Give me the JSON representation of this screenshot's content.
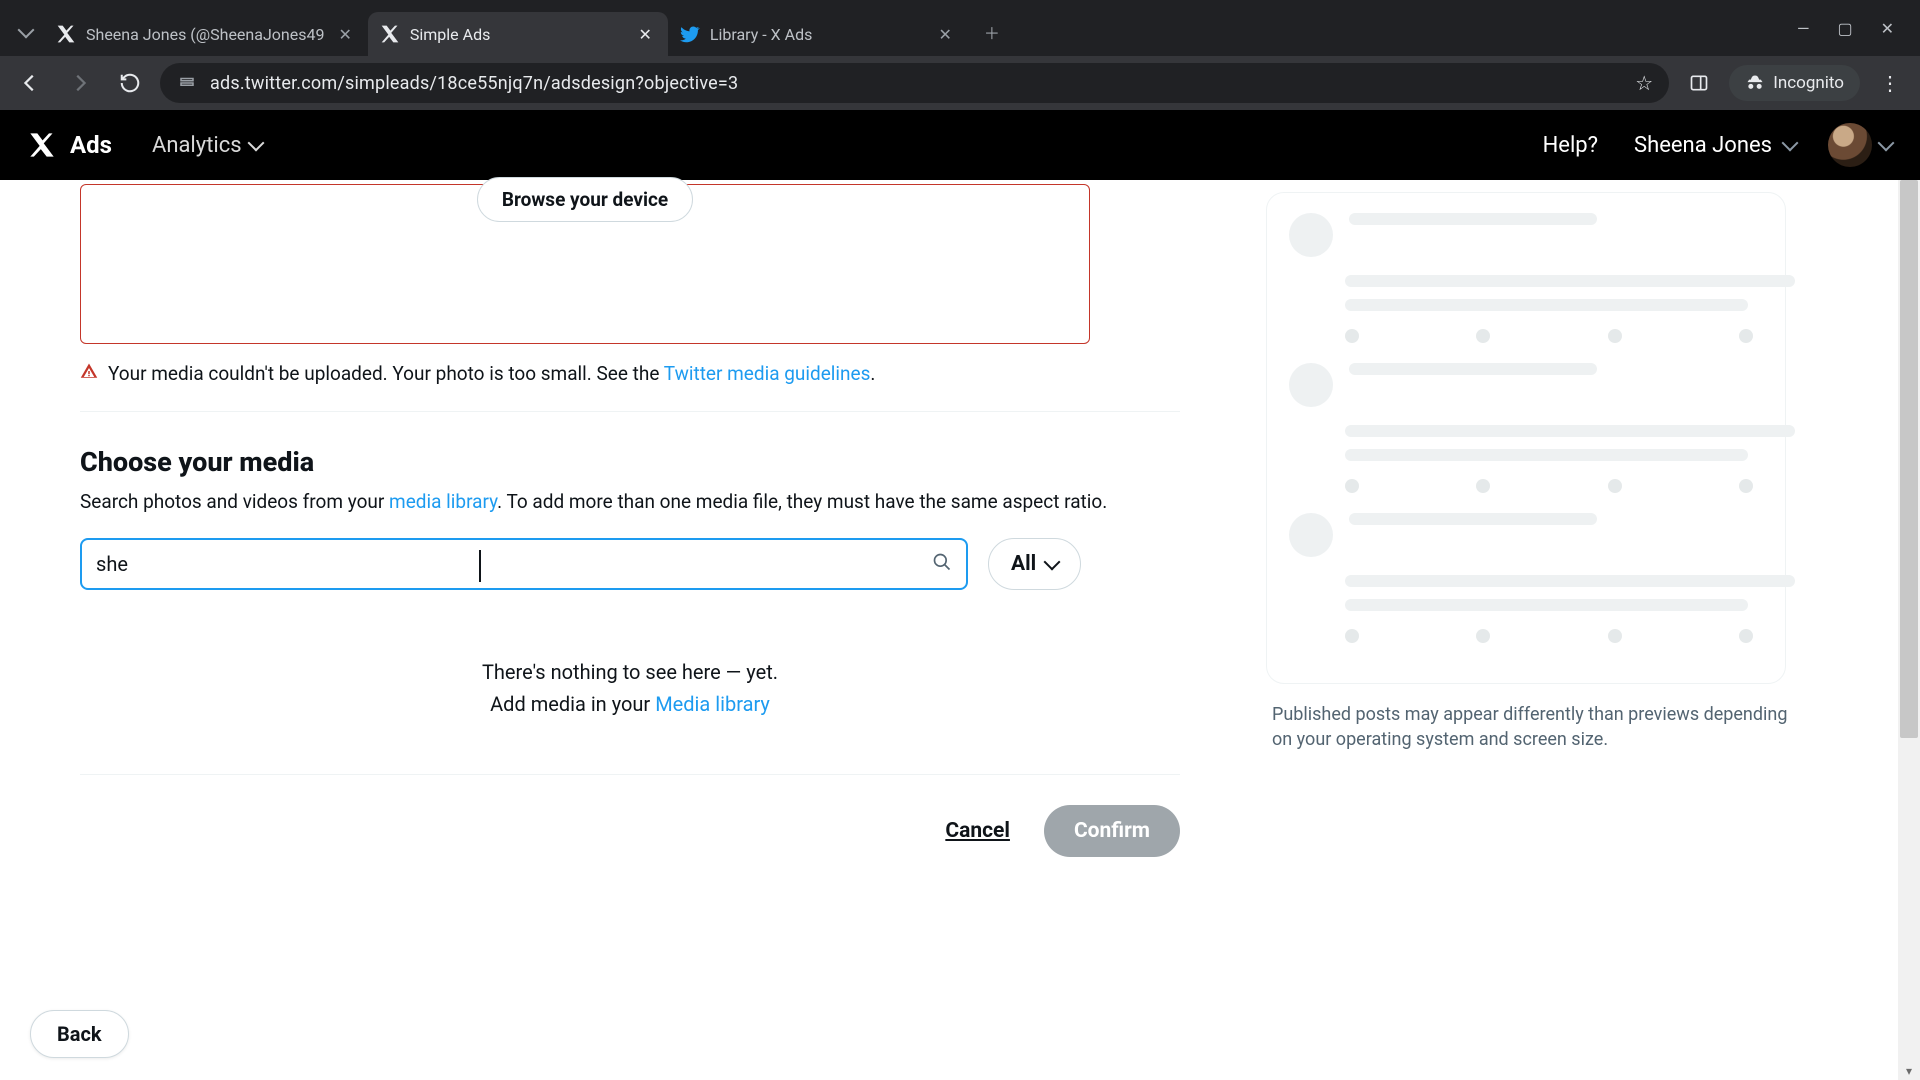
{
  "browser": {
    "tabs": [
      {
        "title": "Sheena Jones (@SheenaJones49"
      },
      {
        "title": "Simple Ads"
      },
      {
        "title": "Library - X Ads"
      }
    ],
    "url": "ads.twitter.com/simpleads/18ce55njq7n/adsdesign?objective=3",
    "incognito_label": "Incognito"
  },
  "header": {
    "brand": "Ads",
    "analytics": "Analytics",
    "help": "Help?",
    "user": "Sheena Jones"
  },
  "upload": {
    "browse_label": "Browse your device",
    "error_text": "Your media couldn't be uploaded. Your photo is too small. See the ",
    "error_link": "Twitter media guidelines",
    "error_suffix": "."
  },
  "choose": {
    "title": "Choose your media",
    "desc_pre": "Search photos and videos from your ",
    "desc_link": "media library",
    "desc_post": ". To add more than one media file, they must have the same aspect ratio.",
    "search_value": "she",
    "filter_label": "All",
    "empty_line1": "There's nothing to see here — yet.",
    "empty_pre": "Add media in your ",
    "empty_link": "Media library"
  },
  "actions": {
    "cancel": "Cancel",
    "confirm": "Confirm",
    "back": "Back"
  },
  "preview": {
    "note": "Published posts may appear differently than previews depending on your operating system and screen size."
  }
}
